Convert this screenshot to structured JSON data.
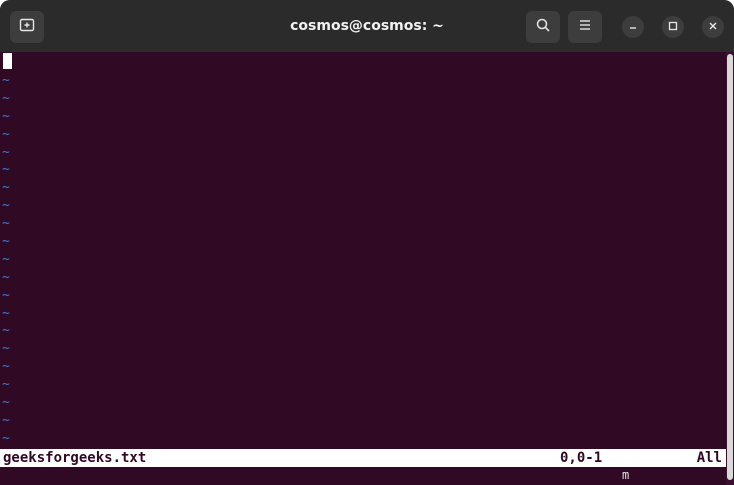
{
  "window": {
    "title": "cosmos@cosmos: ~"
  },
  "titlebar_icons": {
    "new_tab": "new-tab-icon",
    "search": "search-icon",
    "menu": "hamburger-menu-icon",
    "minimize": "minimize-icon",
    "maximize": "maximize-icon",
    "close": "close-icon"
  },
  "editor": {
    "tilde_char": "~",
    "status_filename": "geeksforgeeks.txt",
    "status_position": "0,0-1",
    "status_scroll": "All",
    "command_line": "m"
  },
  "colors": {
    "terminal_bg": "#300a24",
    "tilde": "#3b7bd4",
    "titlebar_bg": "#2b2b2b"
  }
}
